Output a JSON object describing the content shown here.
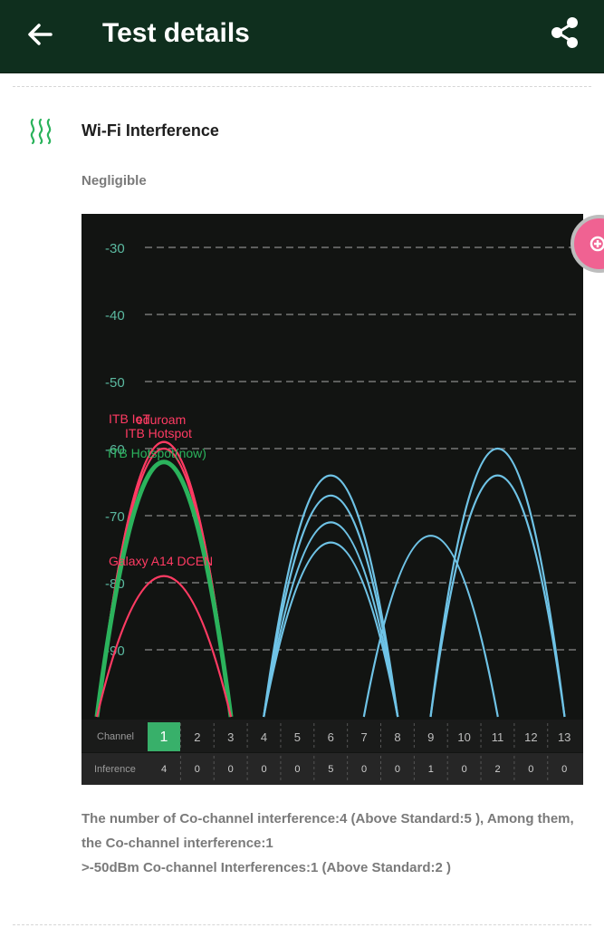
{
  "header": {
    "title": "Test details"
  },
  "section": {
    "title": "Wi-Fi Interference",
    "status": "Negligible"
  },
  "chart_data": {
    "type": "line",
    "ylim": [
      -100,
      -25
    ],
    "y_ticks": [
      -30,
      -40,
      -50,
      -60,
      -70,
      -80,
      -90
    ],
    "grid": true,
    "row_labels": {
      "channel": "Channel",
      "inference": "Inference"
    },
    "channels": [
      "1",
      "2",
      "3",
      "4",
      "5",
      "6",
      "7",
      "8",
      "9",
      "10",
      "11",
      "12",
      "13"
    ],
    "selected_channel": "1",
    "inference": [
      "4",
      "0",
      "0",
      "0",
      "0",
      "5",
      "0",
      "0",
      "1",
      "0",
      "2",
      "0",
      "0"
    ],
    "colors": {
      "self": "#2bb35c",
      "cochannel": "#ff3b63",
      "other": "#6fc3e6",
      "selected": "#38b06a"
    },
    "series": [
      {
        "name": "ITB IoT",
        "channel": 1,
        "rssi": -59,
        "group": "cochannel"
      },
      {
        "name": "eduroam",
        "channel": 1,
        "rssi": -59,
        "group": "cochannel"
      },
      {
        "name": "ITB Hotspot",
        "channel": 1,
        "rssi": -60,
        "group": "cochannel"
      },
      {
        "name": "ITB Hotspot(now)",
        "channel": 1,
        "rssi": -62,
        "group": "self"
      },
      {
        "name": "Galaxy A14 DCEN",
        "channel": 1,
        "rssi": -79,
        "group": "cochannel"
      },
      {
        "name": "",
        "channel": 6,
        "rssi": -64,
        "group": "other"
      },
      {
        "name": "",
        "channel": 6,
        "rssi": -67,
        "group": "other"
      },
      {
        "name": "",
        "channel": 6,
        "rssi": -71,
        "group": "other"
      },
      {
        "name": "",
        "channel": 6,
        "rssi": -74,
        "group": "other"
      },
      {
        "name": "",
        "channel": 9,
        "rssi": -73,
        "group": "other"
      },
      {
        "name": "",
        "channel": 11,
        "rssi": -60,
        "group": "other"
      },
      {
        "name": "",
        "channel": 11,
        "rssi": -64,
        "group": "other"
      }
    ]
  },
  "notes": {
    "line1": "The number of Co-channel interference:4 (Above Standard:5 ), Among them,",
    "line2": "the Co-channel interference:1",
    "line3": ">-50dBm Co-channel Interferences:1 (Above Standard:2 )"
  }
}
